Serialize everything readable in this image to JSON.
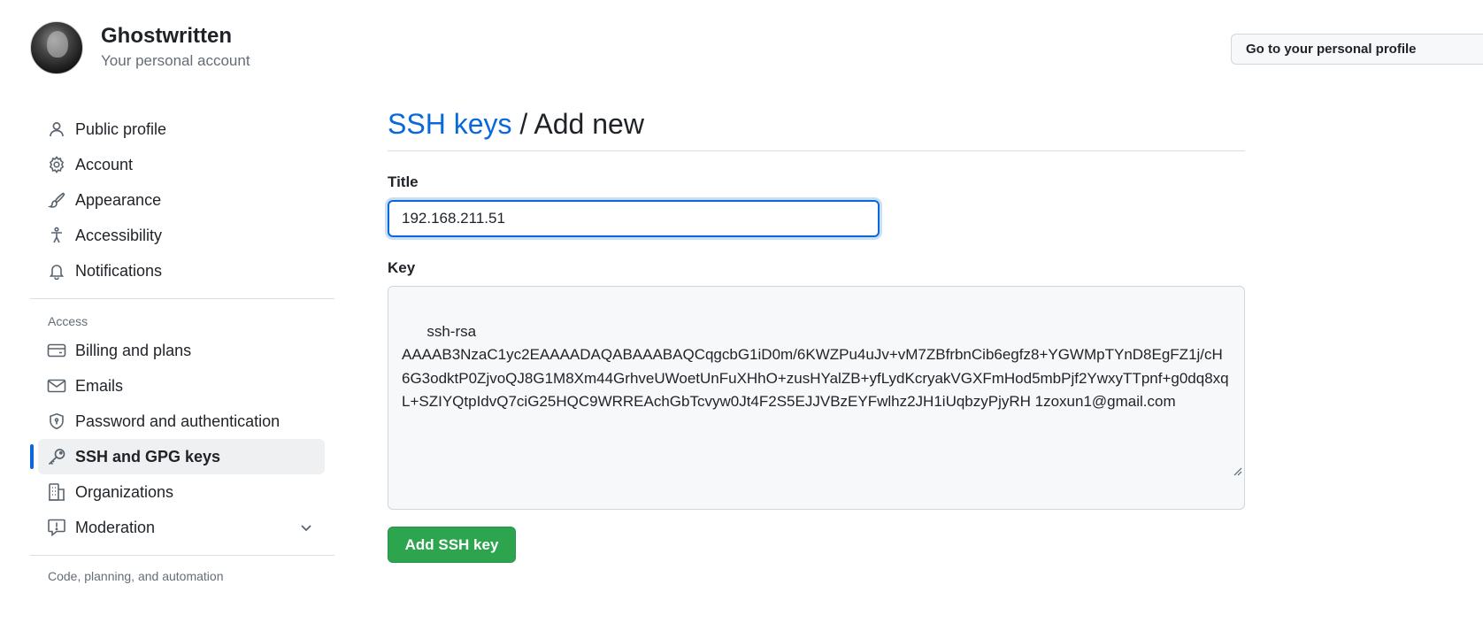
{
  "account": {
    "name": "Ghostwritten",
    "subtitle": "Your personal account",
    "profile_button": "Go to your personal profile"
  },
  "sidebar": {
    "items": [
      {
        "label": "Public profile",
        "icon": "person-icon"
      },
      {
        "label": "Account",
        "icon": "gear-icon"
      },
      {
        "label": "Appearance",
        "icon": "paintbrush-icon"
      },
      {
        "label": "Accessibility",
        "icon": "accessibility-icon"
      },
      {
        "label": "Notifications",
        "icon": "bell-icon"
      }
    ],
    "access_label": "Access",
    "access_items": [
      {
        "label": "Billing and plans",
        "icon": "credit-card-icon"
      },
      {
        "label": "Emails",
        "icon": "mail-icon"
      },
      {
        "label": "Password and authentication",
        "icon": "shield-icon"
      },
      {
        "label": "SSH and GPG keys",
        "icon": "key-icon",
        "active": true
      },
      {
        "label": "Organizations",
        "icon": "organization-icon"
      },
      {
        "label": "Moderation",
        "icon": "report-icon"
      }
    ],
    "code_label": "Code, planning, and automation"
  },
  "main": {
    "breadcrumb_link": "SSH keys",
    "breadcrumb_sep": "/",
    "breadcrumb_current": "Add new",
    "title_label": "Title",
    "title_value": "192.168.211.51",
    "key_label": "Key",
    "key_value": "ssh-rsa\nAAAAB3NzaC1yc2EAAAADAQABAAABAQCqgcbG1iD0m/6KWZPu4uJv+vM7ZBfrbnCib6egfz8+YGWMpTYnD8EgFZ1j/cH6G3odktP0ZjvoQJ8G1M8Xm44GrhveUWoetUnFuXHhO+zusHYalZB+yfLydKcryakVGXFmHod5mbPjf2YwxyTTpnf+g0dq8xqL+SZIYQtpIdvQ7ciG25HQC9WRREAchGbTcvyw0Jt4F2S5EJJVBzEYFwlhz2JH1iUqbzyPjyRH 1zoxun1@gmail.com",
    "submit_label": "Add SSH key"
  },
  "colors": {
    "accent": "#0969da",
    "button_green": "#2da44e",
    "active_bg": "#eef0f2"
  }
}
